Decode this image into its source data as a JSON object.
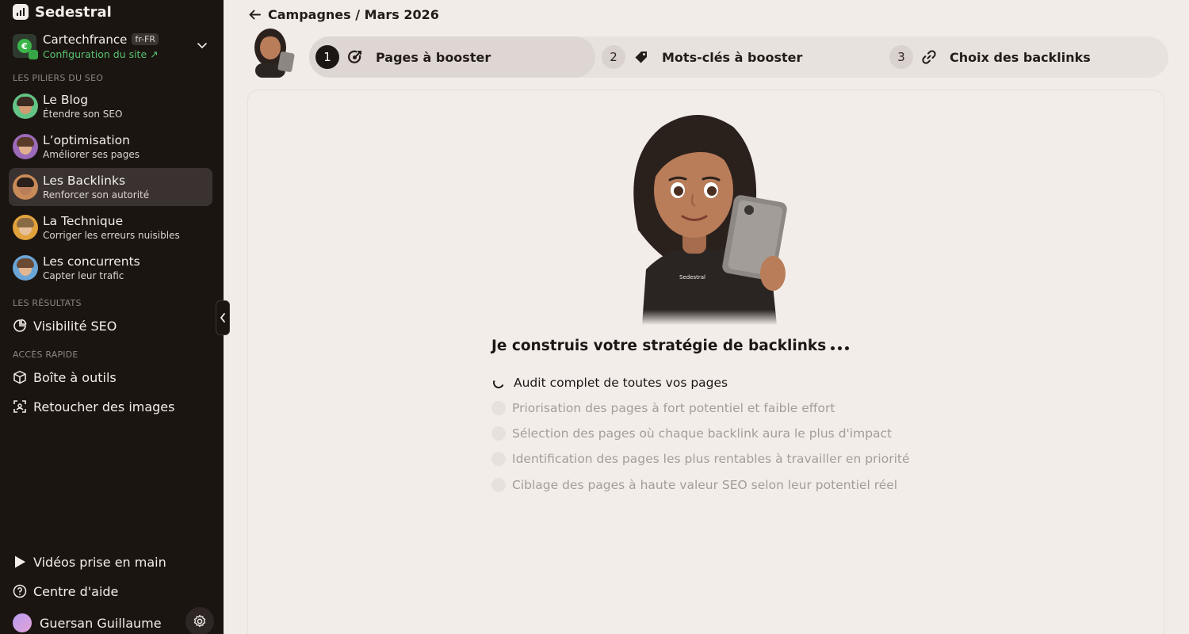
{
  "brand": {
    "name": "Sedestral"
  },
  "site": {
    "name": "Cartechfrance",
    "lang": "fr-FR",
    "config_link": "Configuration du site ↗"
  },
  "sections": {
    "piliers": "LES PILIERS DU SEO",
    "resultats": "LES RÉSULTATS",
    "acces": "ACCÈS RAPIDE"
  },
  "nav": [
    {
      "title": "Le Blog",
      "subtitle": "Étendre son SEO"
    },
    {
      "title": "L’optimisation",
      "subtitle": "Améliorer ses pages"
    },
    {
      "title": "Les Backlinks",
      "subtitle": "Renforcer son autorité"
    },
    {
      "title": "La Technique",
      "subtitle": "Corriger les erreurs nuisibles"
    },
    {
      "title": "Les concurrents",
      "subtitle": "Capter leur trafic"
    }
  ],
  "results": {
    "visibility": "Visibilité SEO"
  },
  "quick": {
    "toolbox": "Boîte à outils",
    "retouch": "Retoucher des images"
  },
  "bottom": {
    "videos": "Vidéos prise en main",
    "help": "Centre d'aide",
    "user": "Guersan Guillaume"
  },
  "breadcrumb": "Campagnes / Mars 2026",
  "steps": [
    {
      "num": "1",
      "label": "Pages à booster",
      "icon": "target-icon"
    },
    {
      "num": "2",
      "label": "Mots-clés à booster",
      "icon": "tag-icon"
    },
    {
      "num": "3",
      "label": "Choix des backlinks",
      "icon": "link-icon"
    }
  ],
  "loading": {
    "title": "Je construis votre stratégie de backlinks",
    "tasks": [
      "Audit complet de toutes vos pages",
      "Priorisation des pages à fort potentiel et faible effort",
      "Sélection des pages où chaque backlink aura le plus d'impact",
      "Identification des pages les plus rentables à travailler en priorité",
      "Ciblage des pages à haute valeur SEO selon leur potentiel réel"
    ]
  },
  "hero_shirt_text": "Sedestral",
  "colors": {
    "sidebar_bg": "#1b1512",
    "page_bg": "#f2ece8",
    "accent_green": "#58c26d",
    "active_step": "#1c1715"
  }
}
